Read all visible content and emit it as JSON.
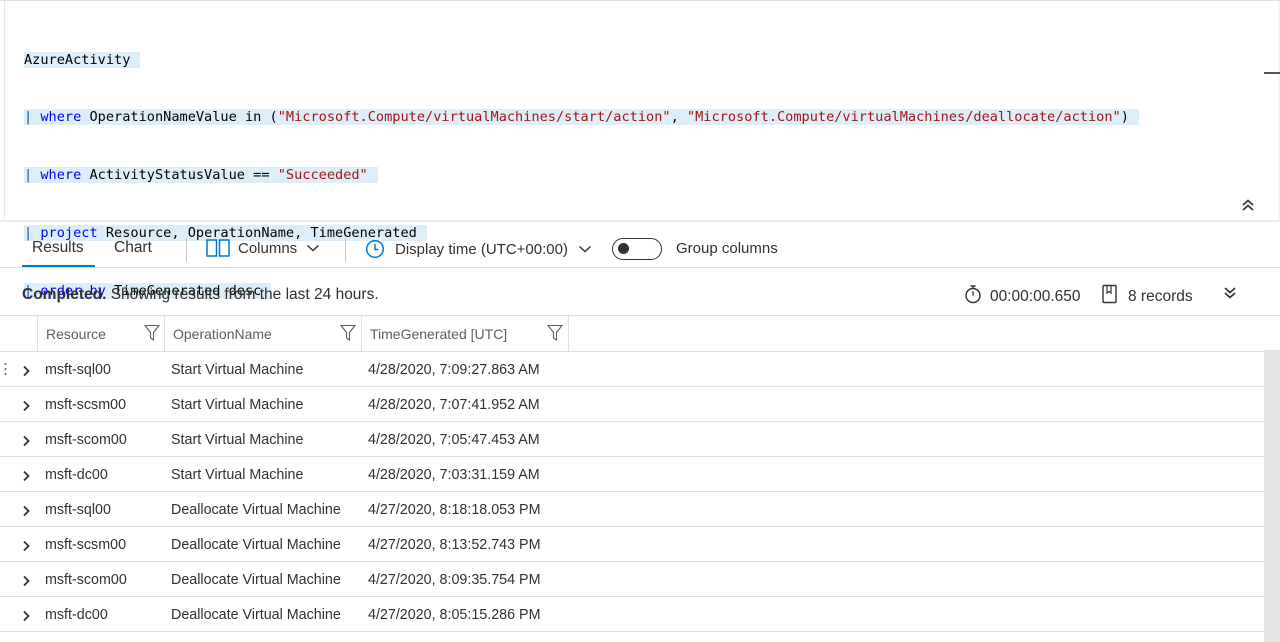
{
  "query": {
    "table": "AzureActivity",
    "lines": [
      {
        "pipe": "|",
        "keyword": "where",
        "pre": " OperationNameValue in (",
        "str1": "\"Microsoft.Compute/virtualMachines/start/action\"",
        "mid": ", ",
        "str2": "\"Microsoft.Compute/virtualMachines/deallocate/action\"",
        "post": ")"
      },
      {
        "pipe": "|",
        "keyword": "where",
        "pre": " ActivityStatusValue == ",
        "str1": "\"Succeeded\""
      },
      {
        "pipe": "|",
        "keyword": "project",
        "pre": " Resource, OperationName, TimeGenerated"
      },
      {
        "pipe": "|",
        "keyword": "order by",
        "pre": " TimeGenerated desc"
      }
    ]
  },
  "splitter": "...",
  "tabs": {
    "results": "Results",
    "chart": "Chart"
  },
  "toolbar": {
    "columns_label": "Columns",
    "display_time_label": "Display time (UTC+00:00)",
    "group_columns_label": "Group columns",
    "group_columns_on": false
  },
  "status": {
    "state": "Completed.",
    "message": " Showing results from the last 24 hours.",
    "duration": "00:00:00.650",
    "records": "8 records"
  },
  "grid": {
    "columns": [
      "Resource",
      "OperationName",
      "TimeGenerated [UTC]"
    ],
    "rows": [
      {
        "resource": "msft-sql00",
        "operation": "Start Virtual Machine",
        "time": "4/28/2020, 7:09:27.863 AM"
      },
      {
        "resource": "msft-scsm00",
        "operation": "Start Virtual Machine",
        "time": "4/28/2020, 7:07:41.952 AM"
      },
      {
        "resource": "msft-scom00",
        "operation": "Start Virtual Machine",
        "time": "4/28/2020, 7:05:47.453 AM"
      },
      {
        "resource": "msft-dc00",
        "operation": "Start Virtual Machine",
        "time": "4/28/2020, 7:03:31.159 AM"
      },
      {
        "resource": "msft-sql00",
        "operation": "Deallocate Virtual Machine",
        "time": "4/27/2020, 8:18:18.053 PM"
      },
      {
        "resource": "msft-scsm00",
        "operation": "Deallocate Virtual Machine",
        "time": "4/27/2020, 8:13:52.743 PM"
      },
      {
        "resource": "msft-scom00",
        "operation": "Deallocate Virtual Machine",
        "time": "4/27/2020, 8:09:35.754 PM"
      },
      {
        "resource": "msft-dc00",
        "operation": "Deallocate Virtual Machine",
        "time": "4/27/2020, 8:05:15.286 PM"
      }
    ]
  },
  "colors": {
    "accent": "#0078d4",
    "keyword": "#0000ff",
    "string": "#a31515",
    "pipe": "#0b56b8",
    "highlight": "#ddeef8"
  },
  "icons": [
    "chevron-double-up-icon",
    "columns-icon",
    "chevron-down-icon",
    "clock-icon",
    "stopwatch-icon",
    "records-icon",
    "chevron-double-down-icon",
    "filter-icon",
    "chevron-right-icon"
  ]
}
